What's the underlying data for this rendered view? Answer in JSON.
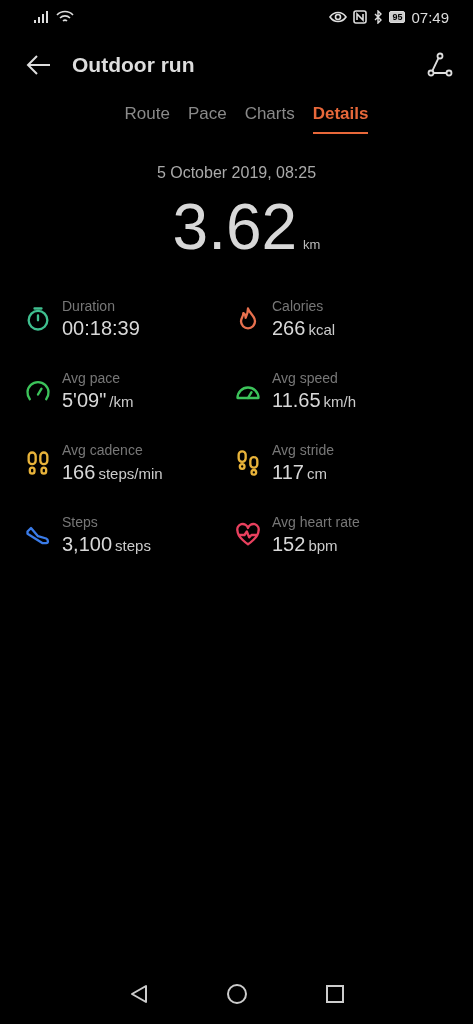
{
  "status_bar": {
    "battery": "95",
    "time": "07:49"
  },
  "header": {
    "title": "Outdoor run"
  },
  "tabs": [
    {
      "label": "Route",
      "selected": false
    },
    {
      "label": "Pace",
      "selected": false
    },
    {
      "label": "Charts",
      "selected": false
    },
    {
      "label": "Details",
      "selected": true
    }
  ],
  "summary": {
    "date": "5 October 2019, 08:25",
    "distance": "3.62",
    "unit": "km"
  },
  "stats": [
    {
      "kind": "stopwatch",
      "color": "#3fbf8f",
      "label": "Duration",
      "value": "00:18:39"
    },
    {
      "kind": "flame",
      "color": "#e8704e",
      "label": "Calories",
      "value": "266",
      "unit": "kcal"
    },
    {
      "kind": "gauge",
      "color": "#3cc35a",
      "label": "Avg pace",
      "value": "5'09\"",
      "unit": "/km"
    },
    {
      "kind": "speedometer",
      "color": "#3cc35a",
      "label": "Avg speed",
      "value": "11.65",
      "unit": "km/h"
    },
    {
      "kind": "footprints",
      "color": "#e8b33a",
      "label": "Avg cadence",
      "value": "166",
      "unit": "steps/min"
    },
    {
      "kind": "stride",
      "color": "#e8b33a",
      "label": "Avg stride",
      "value": "117",
      "unit": "cm"
    },
    {
      "kind": "shoe",
      "color": "#3a7be8",
      "label": "Steps",
      "value": "3,100",
      "unit": "steps"
    },
    {
      "kind": "heart",
      "color": "#e8405e",
      "label": "Avg heart rate",
      "value": "152",
      "unit": "bpm"
    }
  ]
}
